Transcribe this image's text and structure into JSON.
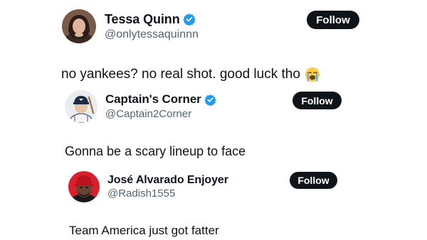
{
  "colors": {
    "verified": "#1d9bf0",
    "follow_bg": "#0f1419",
    "follow_text": "#ffffff",
    "handle": "#536471",
    "text": "#0f1419"
  },
  "posts": [
    {
      "name": "Tessa Quinn",
      "verified": true,
      "handle": "@onlytessaquinnn",
      "follow_label": "Follow",
      "text": "no yankees? no real shot. good luck tho",
      "emoji": "loudly-crying-face-icon"
    },
    {
      "name": "Captain's Corner",
      "verified": true,
      "handle": "@Captain2Corner",
      "follow_label": "Follow",
      "text": "Gonna be a scary lineup to face"
    },
    {
      "name": "José Alvarado Enjoyer",
      "verified": false,
      "handle": "@Radish1555",
      "follow_label": "Follow",
      "text": "Team America just got fatter"
    }
  ]
}
